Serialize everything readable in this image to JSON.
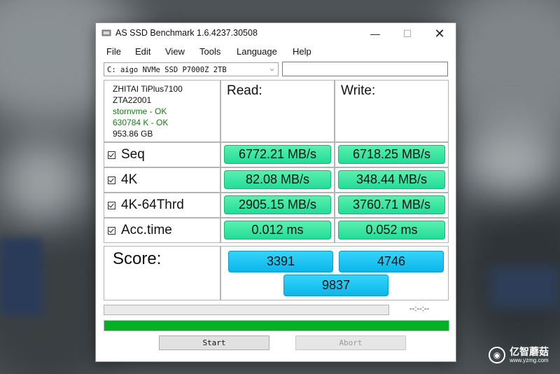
{
  "window": {
    "title": "AS SSD Benchmark 1.6.4237.30508",
    "controls": {
      "minimize": "—",
      "maximize": "☐",
      "close": "✕"
    }
  },
  "menu": [
    "File",
    "Edit",
    "View",
    "Tools",
    "Language",
    "Help"
  ],
  "drive": {
    "selected": "C: aigo NVMe SSD P7000Z 2TB",
    "arrow": "⌵"
  },
  "info": {
    "model": "ZHITAI TiPlus7100",
    "firmware": "ZTA22001",
    "driver": "stornvme - OK",
    "alignment": "630784 K - OK",
    "capacity": "953.86 GB",
    "ok_color": "#1a7a1a"
  },
  "headers": {
    "read": "Read:",
    "write": "Write:"
  },
  "rows": [
    {
      "label": "Seq",
      "read": "6772.21 MB/s",
      "write": "6718.25 MB/s"
    },
    {
      "label": "4K",
      "read": "82.08 MB/s",
      "write": "348.44 MB/s"
    },
    {
      "label": "4K-64Thrd",
      "read": "2905.15 MB/s",
      "write": "3760.71 MB/s"
    },
    {
      "label": "Acc.time",
      "read": "0.012 ms",
      "write": "0.052 ms"
    }
  ],
  "score": {
    "label": "Score:",
    "read": "3391",
    "write": "4746",
    "total": "9837"
  },
  "progress": {
    "time": "--:--:--",
    "main_fraction": 1.0,
    "small_fraction": 0.0
  },
  "buttons": {
    "start": "Start",
    "abort": "Abort"
  },
  "watermark": {
    "name": "亿智蘑菇",
    "url": "www.yzmg.com"
  },
  "colors": {
    "result_green": "#2ee3a0",
    "score_blue": "#1ec2f2",
    "progress_green": "#06b025"
  }
}
